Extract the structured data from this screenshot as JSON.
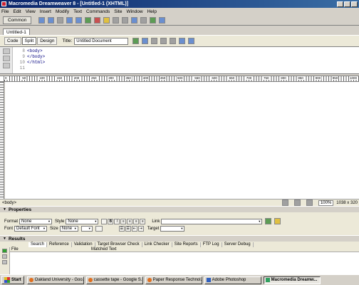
{
  "window": {
    "title": "Macromedia Dreamweaver 8 - [Untitled-1 (XHTML)]"
  },
  "menu": [
    "File",
    "Edit",
    "View",
    "Insert",
    "Modify",
    "Text",
    "Commands",
    "Site",
    "Window",
    "Help"
  ],
  "insert_bar": {
    "category": "Common"
  },
  "document": {
    "tab": "Untitled-1",
    "view_buttons": {
      "code": "Code",
      "split": "Split",
      "design": "Design"
    },
    "title_label": "Title:",
    "title_value": "Untitled Document"
  },
  "code": {
    "line_numbers": [
      "8",
      "9",
      "10",
      "11"
    ],
    "lines": [
      "<body>",
      "</body>",
      "</html>",
      ""
    ]
  },
  "ruler_labels": [
    "0",
    "50",
    "100",
    "150",
    "200",
    "250",
    "300",
    "350",
    "400",
    "450",
    "500",
    "550",
    "600",
    "650",
    "700",
    "750",
    "800",
    "850",
    "900",
    "950",
    "1000"
  ],
  "status": {
    "tag": "<body>",
    "zoom": "100%",
    "dimensions": "1038 x 320"
  },
  "properties": {
    "header": "Properties",
    "format_label": "Format",
    "format_value": "None",
    "style_label": "Style",
    "style_value": "None",
    "font_label": "Font",
    "font_value": "Default Font",
    "size_label": "Size",
    "size_value": "None",
    "link_label": "Link",
    "target_label": "Target",
    "bold": "B",
    "italic": "I"
  },
  "results": {
    "header": "Results",
    "tabs": [
      "Search",
      "Reference",
      "Validation",
      "Target Browser Check",
      "Link Checker",
      "Site Reports",
      "FTP Log",
      "Server Debug"
    ],
    "columns": [
      "File",
      "Matched Text"
    ]
  },
  "taskbar": {
    "start": "Start",
    "items": [
      "Oakland University - Goo...",
      "cassette tape - Google S...",
      "Paper Response Technol...",
      "Adobe Photoshop",
      "Macromedia Dreamw..."
    ]
  }
}
